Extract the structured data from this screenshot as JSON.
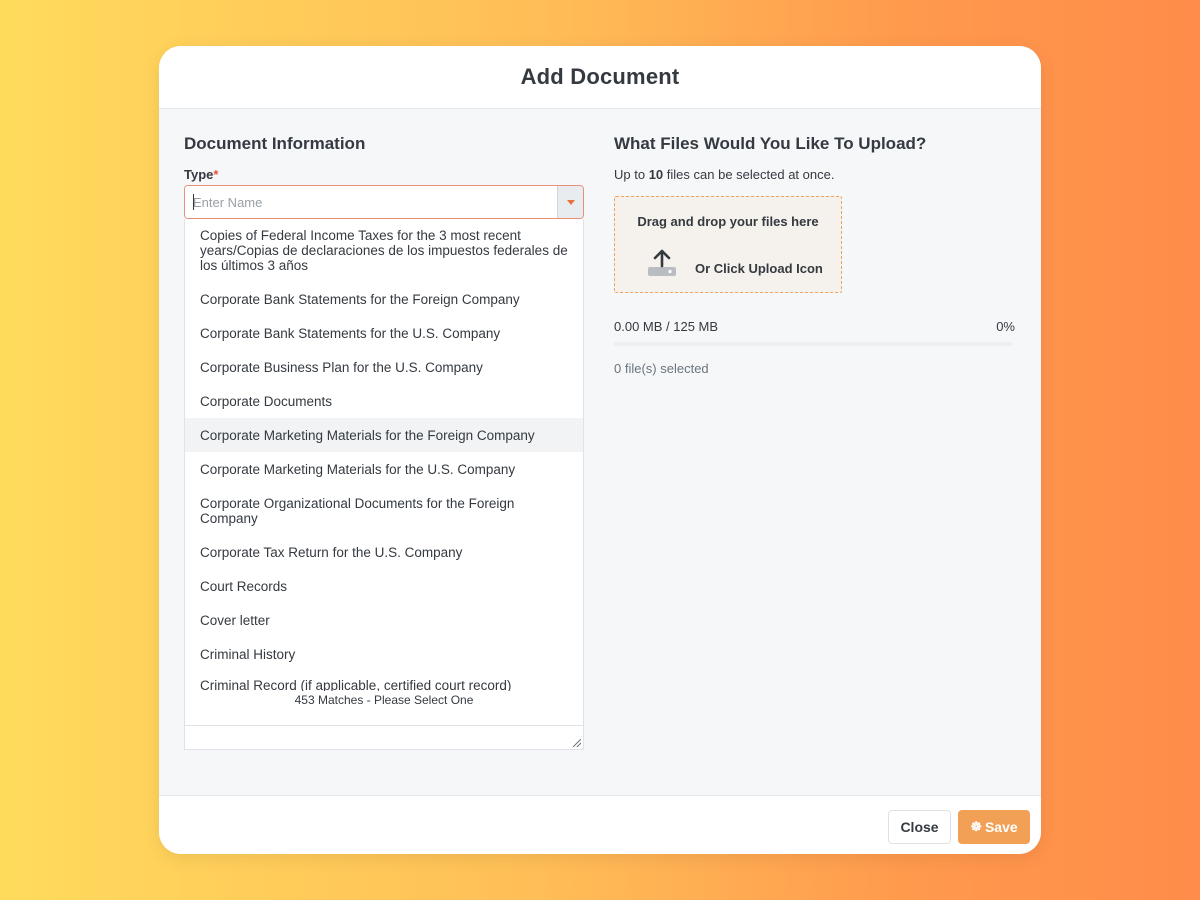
{
  "modal": {
    "title": "Add Document"
  },
  "document_info": {
    "heading": "Document Information",
    "type_label": "Type",
    "required_marker": "*",
    "type_placeholder": "Enter Name",
    "type_value": "",
    "dropdown_icon": "triangle-down-icon",
    "options": [
      "Copies of Federal Income Taxes for the 3 most recent years/Copias de declaraciones de los impuestos federales de los últimos 3 años",
      "Corporate Bank Statements for the Foreign Company",
      "Corporate Bank Statements for the U.S. Company",
      "Corporate Business Plan for the U.S. Company",
      "Corporate Documents",
      "Corporate Marketing Materials for the Foreign Company",
      "Corporate Marketing Materials for the U.S. Company",
      "Corporate Organizational Documents for the Foreign Company",
      "Corporate Tax Return for the U.S. Company",
      "Court Records",
      "Cover letter",
      "Criminal History",
      "Criminal Record (if applicable, certified court record)"
    ],
    "highlighted_option_index": 5,
    "match_summary": "453 Matches - Please Select One"
  },
  "upload": {
    "heading": "What Files Would You Like To Upload?",
    "note_prefix": "Up to",
    "note_count": "10",
    "note_suffix": "files can be selected at once.",
    "dropzone_title": "Drag and drop your files here",
    "dropzone_link": "Or Click Upload Icon",
    "upload_icon": "upload-icon",
    "size_text": "0.00 MB / 125 MB",
    "percent_text": "0%",
    "progress_percent": 0,
    "files_selected": "0 file(s) selected"
  },
  "footer": {
    "close_label": "Close",
    "save_label": "Save",
    "save_icon": "spinner-icon"
  },
  "colors": {
    "accent": "#f3a057",
    "invalid_border": "#e8907a",
    "dropzone_border": "#f0a15c"
  }
}
